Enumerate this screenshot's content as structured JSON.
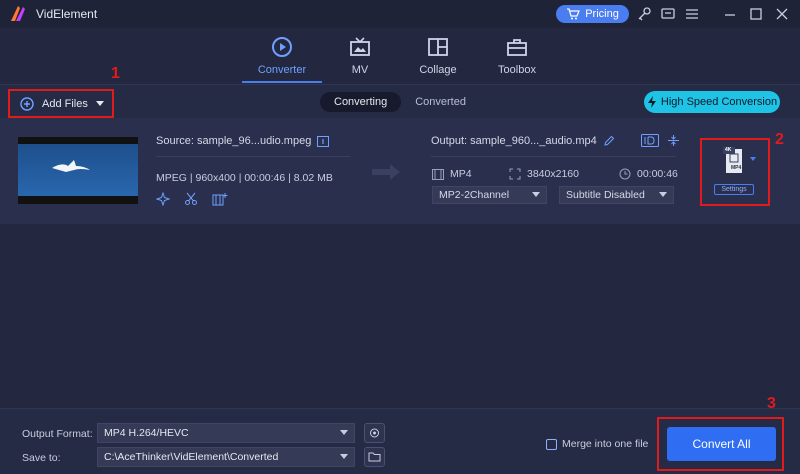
{
  "app": {
    "title": "VidElement"
  },
  "titlebar": {
    "pricing_label": "Pricing"
  },
  "nav": {
    "tabs": [
      {
        "label": "Converter",
        "icon": "converter-icon",
        "active": true
      },
      {
        "label": "MV",
        "icon": "tv-icon",
        "active": false
      },
      {
        "label": "Collage",
        "icon": "collage-icon",
        "active": false
      },
      {
        "label": "Toolbox",
        "icon": "toolbox-icon",
        "active": false
      }
    ]
  },
  "toolbar": {
    "add_files_label": "Add Files",
    "subtabs": [
      {
        "label": "Converting",
        "active": true
      },
      {
        "label": "Converted",
        "active": false
      }
    ],
    "high_speed_label": "High Speed Conversion"
  },
  "file": {
    "source_name": "Source: sample_96...udio.mpeg",
    "source_format": "MPEG",
    "source_resolution": "960x400",
    "source_duration": "00:00:46",
    "source_size": "8.02 MB",
    "output_name": "Output: sample_960..._audio.mp4",
    "output_format": "MP4",
    "output_resolution": "3840x2160",
    "output_duration": "00:00:46",
    "audio_track": "MP2-2Channel",
    "subtitle": "Subtitle Disabled",
    "format_badge_top": "4K",
    "format_badge": "MP4",
    "settings_label": "Settings"
  },
  "annotations": [
    "1",
    "2",
    "3"
  ],
  "bottom": {
    "output_format_label": "Output Format:",
    "output_format_value": "MP4 H.264/HEVC",
    "save_to_label": "Save to:",
    "save_to_value": "C:\\AceThinker\\VidElement\\Converted",
    "merge_label": "Merge into one file",
    "convert_all_label": "Convert All"
  },
  "colors": {
    "accent": "#4a7df0",
    "highlight": "#e01b1b",
    "cyan": "#1ec3e6",
    "bg": "#232840"
  }
}
